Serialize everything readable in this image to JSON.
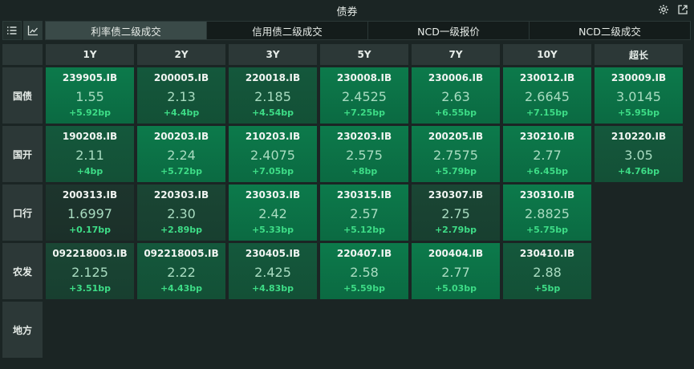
{
  "window": {
    "title": "债券"
  },
  "tabs": [
    {
      "label": "利率债二级成交",
      "active": true
    },
    {
      "label": "信用债二级成交",
      "active": false
    },
    {
      "label": "NCD一级报价",
      "active": false
    },
    {
      "label": "NCD二级成交",
      "active": false
    }
  ],
  "icons": {
    "settings": "gear-icon",
    "popout": "external-link-icon",
    "list": "list-icon",
    "chart": "line-chart-icon"
  },
  "colors": {
    "change_positive": "#3ddc86",
    "cell_strong": "#0b6c44",
    "cell_weak": "#1a4a36",
    "cell_dark": "#1e3a30"
  },
  "columns": [
    "1Y",
    "2Y",
    "3Y",
    "5Y",
    "7Y",
    "10Y",
    "超长"
  ],
  "rows": [
    {
      "label": "国债",
      "cells": [
        {
          "code": "239905.IB",
          "yield": "1.55",
          "change": "+5.92bp",
          "shade": "strong"
        },
        {
          "code": "200005.IB",
          "yield": "2.13",
          "change": "+4.4bp",
          "shade": "mid"
        },
        {
          "code": "220018.IB",
          "yield": "2.185",
          "change": "+4.54bp",
          "shade": "mid"
        },
        {
          "code": "230008.IB",
          "yield": "2.4525",
          "change": "+7.25bp",
          "shade": "strong"
        },
        {
          "code": "230006.IB",
          "yield": "2.63",
          "change": "+6.55bp",
          "shade": "strong"
        },
        {
          "code": "230012.IB",
          "yield": "2.6645",
          "change": "+7.15bp",
          "shade": "strong"
        },
        {
          "code": "230009.IB",
          "yield": "3.0145",
          "change": "+5.95bp",
          "shade": "strong"
        }
      ]
    },
    {
      "label": "国开",
      "cells": [
        {
          "code": "190208.IB",
          "yield": "2.11",
          "change": "+4bp",
          "shade": "mid"
        },
        {
          "code": "200203.IB",
          "yield": "2.24",
          "change": "+5.72bp",
          "shade": "strong"
        },
        {
          "code": "210203.IB",
          "yield": "2.4075",
          "change": "+7.05bp",
          "shade": "strong"
        },
        {
          "code": "230203.IB",
          "yield": "2.575",
          "change": "+8bp",
          "shade": "strong"
        },
        {
          "code": "200205.IB",
          "yield": "2.7575",
          "change": "+5.79bp",
          "shade": "strong"
        },
        {
          "code": "230210.IB",
          "yield": "2.77",
          "change": "+6.45bp",
          "shade": "strong"
        },
        {
          "code": "210220.IB",
          "yield": "3.05",
          "change": "+4.76bp",
          "shade": "mid"
        }
      ]
    },
    {
      "label": "口行",
      "cells": [
        {
          "code": "200313.IB",
          "yield": "1.6997",
          "change": "+0.17bp",
          "shade": "dark"
        },
        {
          "code": "220303.IB",
          "yield": "2.30",
          "change": "+2.89bp",
          "shade": "weak"
        },
        {
          "code": "230303.IB",
          "yield": "2.42",
          "change": "+5.33bp",
          "shade": "strong"
        },
        {
          "code": "230315.IB",
          "yield": "2.57",
          "change": "+5.12bp",
          "shade": "strong"
        },
        {
          "code": "230307.IB",
          "yield": "2.75",
          "change": "+2.79bp",
          "shade": "weak"
        },
        {
          "code": "230310.IB",
          "yield": "2.8825",
          "change": "+5.75bp",
          "shade": "strong"
        },
        null
      ]
    },
    {
      "label": "农发",
      "cells": [
        {
          "code": "092218003.IB",
          "yield": "2.125",
          "change": "+3.51bp",
          "shade": "weak"
        },
        {
          "code": "092218005.IB",
          "yield": "2.22",
          "change": "+4.43bp",
          "shade": "mid"
        },
        {
          "code": "230405.IB",
          "yield": "2.425",
          "change": "+4.83bp",
          "shade": "mid"
        },
        {
          "code": "220407.IB",
          "yield": "2.58",
          "change": "+5.59bp",
          "shade": "strong"
        },
        {
          "code": "200404.IB",
          "yield": "2.77",
          "change": "+5.03bp",
          "shade": "strong"
        },
        {
          "code": "230410.IB",
          "yield": "2.88",
          "change": "+5bp",
          "shade": "mid"
        },
        null
      ]
    },
    {
      "label": "地方",
      "cells": [
        null,
        null,
        null,
        null,
        null,
        null,
        null
      ]
    }
  ]
}
